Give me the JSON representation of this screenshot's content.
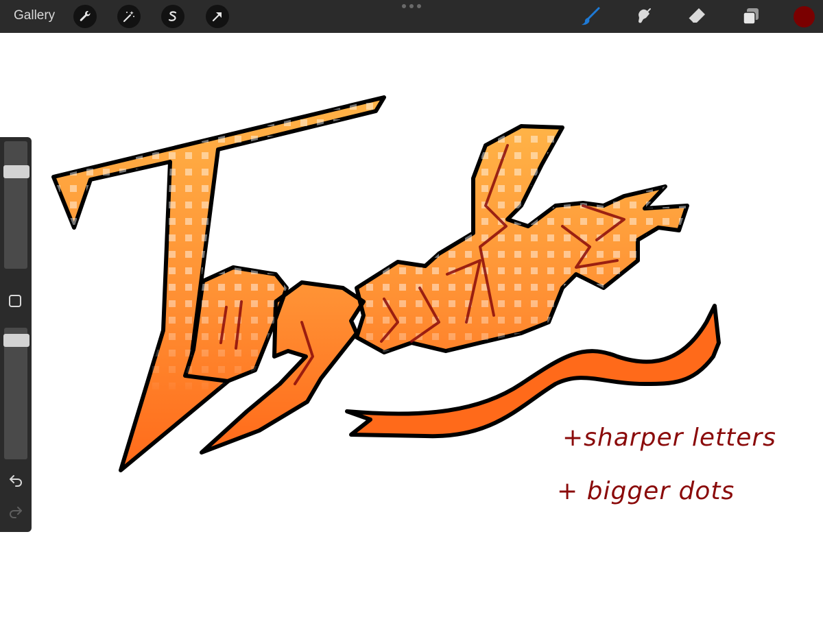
{
  "toolbar": {
    "gallery_label": "Gallery",
    "left_tools": [
      {
        "name": "actions",
        "icon": "wrench-icon"
      },
      {
        "name": "adjustments",
        "icon": "magic-wand-icon"
      },
      {
        "name": "selection",
        "icon": "selection-s-icon"
      },
      {
        "name": "transform",
        "icon": "arrow-cursor-icon"
      }
    ],
    "right_tools": [
      {
        "name": "brush",
        "icon": "brush-icon",
        "active": true
      },
      {
        "name": "smudge",
        "icon": "smudge-icon",
        "active": false
      },
      {
        "name": "eraser",
        "icon": "eraser-icon",
        "active": false
      },
      {
        "name": "layers",
        "icon": "layers-icon",
        "active": false
      }
    ],
    "current_color": "#7a0000",
    "active_tool_color": "#1e7ad6"
  },
  "sidebar": {
    "brush_size_level": 0.79,
    "opacity_level": 0.95,
    "icons": [
      "square-modifier-icon",
      "undo-icon",
      "redo-icon"
    ]
  },
  "artwork": {
    "lettering": "Together",
    "fill_colors": [
      "#ffb347",
      "#ff6a1a"
    ],
    "outline_color": "#000000",
    "notes": [
      "+sharper letters",
      "+ bigger dots"
    ],
    "note_color": "#8a0a0a"
  }
}
